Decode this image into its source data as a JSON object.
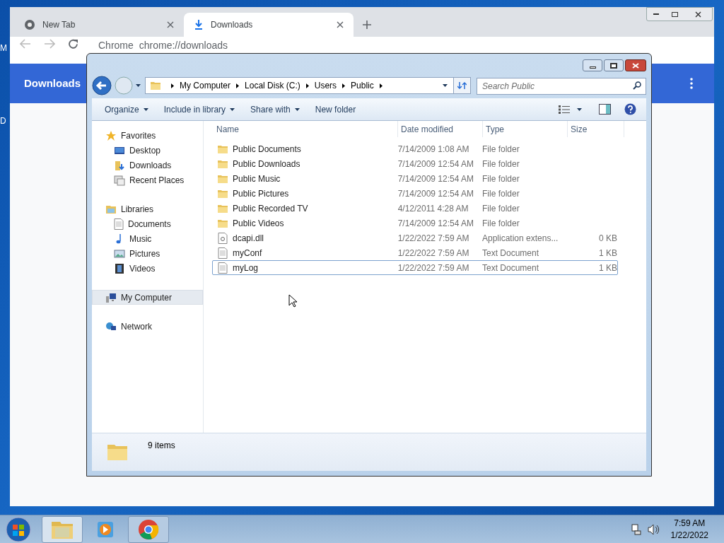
{
  "desktop_icons": [
    {
      "label": "M"
    },
    {
      "label": "D"
    }
  ],
  "chrome": {
    "tabs": [
      {
        "label": "New Tab",
        "kind": "newtab",
        "selected": false
      },
      {
        "label": "Downloads",
        "kind": "download",
        "selected": true
      }
    ],
    "address": {
      "site": "Chrome",
      "url": "chrome://downloads"
    },
    "header": {
      "title": "Downloads"
    }
  },
  "explorer": {
    "breadcrumbs": [
      "My Computer",
      "Local Disk (C:)",
      "Users",
      "Public"
    ],
    "search": {
      "placeholder": "Search Public"
    },
    "toolbar": [
      {
        "label": "Organize",
        "dropdown": true
      },
      {
        "label": "Include in library",
        "dropdown": true
      },
      {
        "label": "Share with",
        "dropdown": true
      },
      {
        "label": "New folder",
        "dropdown": false
      }
    ],
    "nav": [
      {
        "label": "Favorites",
        "kind": "star",
        "selected": false,
        "children": [
          {
            "label": "Desktop",
            "kind": "desktop",
            "selected": false
          },
          {
            "label": "Downloads",
            "kind": "downloads",
            "selected": false
          },
          {
            "label": "Recent Places",
            "kind": "recent",
            "selected": false
          }
        ]
      },
      {
        "label": "Libraries",
        "kind": "library",
        "selected": false,
        "children": [
          {
            "label": "Documents",
            "kind": "doc",
            "selected": false
          },
          {
            "label": "Music",
            "kind": "music",
            "selected": false
          },
          {
            "label": "Pictures",
            "kind": "pictures",
            "selected": false
          },
          {
            "label": "Videos",
            "kind": "videos",
            "selected": false
          }
        ]
      },
      {
        "label": "My Computer",
        "kind": "computer",
        "selected": true
      },
      {
        "label": "Network",
        "kind": "network",
        "selected": false
      }
    ],
    "columns": [
      "Name",
      "Date modified",
      "Type",
      "Size"
    ],
    "files": [
      {
        "name": "Public Documents",
        "kind": "folder",
        "date": "7/14/2009 1:08 AM",
        "type": "File folder",
        "selected": false
      },
      {
        "name": "Public Downloads",
        "kind": "folder",
        "date": "7/14/2009 12:54 AM",
        "type": "File folder",
        "selected": false
      },
      {
        "name": "Public Music",
        "kind": "folder",
        "date": "7/14/2009 12:54 AM",
        "type": "File folder",
        "selected": false
      },
      {
        "name": "Public Pictures",
        "kind": "folder",
        "date": "7/14/2009 12:54 AM",
        "type": "File folder",
        "selected": false
      },
      {
        "name": "Public Recorded TV",
        "kind": "folder",
        "date": "4/12/2011 4:28 AM",
        "type": "File folder",
        "selected": false
      },
      {
        "name": "Public Videos",
        "kind": "folder",
        "date": "7/14/2009 12:54 AM",
        "type": "File folder",
        "selected": false
      },
      {
        "name": "dcapi.dll",
        "kind": "dll",
        "date": "1/22/2022 7:59 AM",
        "type": "Application extens...",
        "size": "0 KB",
        "selected": false
      },
      {
        "name": "myConf",
        "kind": "text",
        "date": "1/22/2022 7:59 AM",
        "type": "Text Document",
        "size": "1 KB",
        "selected": false
      },
      {
        "name": "myLog",
        "kind": "text",
        "date": "1/22/2022 7:59 AM",
        "type": "Text Document",
        "size": "1 KB",
        "selected": true
      }
    ],
    "status": "9 items"
  },
  "taskbar": {
    "apps": [
      {
        "kind": "explorer",
        "selected": true
      },
      {
        "kind": "media",
        "selected": false
      },
      {
        "kind": "chrome",
        "selected": false
      }
    ],
    "time": "7:59 AM",
    "date": "1/22/2022"
  }
}
